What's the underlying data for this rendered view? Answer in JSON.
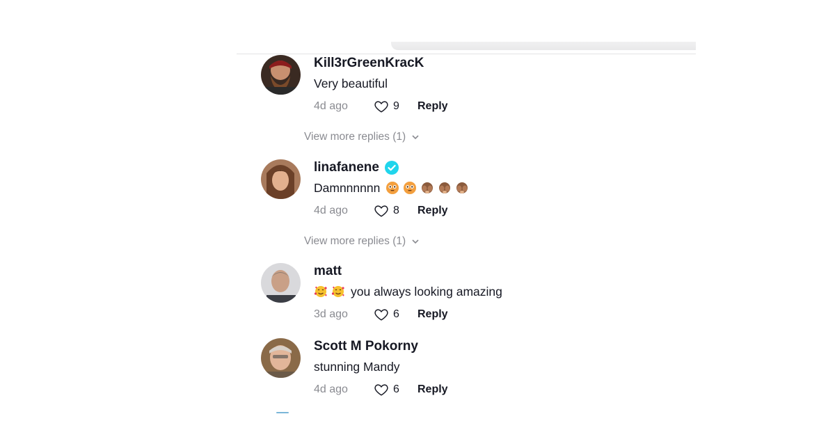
{
  "comments": [
    {
      "username": "Kill3rGreenKracK",
      "text": "Very beautiful",
      "time": "4d ago",
      "likes": "9",
      "reply": "Reply",
      "verified": false
    },
    {
      "username": "linafanene",
      "text": "Damnnnnnn",
      "time": "4d ago",
      "likes": "8",
      "reply": "Reply",
      "verified": true
    },
    {
      "username": "matt",
      "text": "you always looking amazing",
      "time": "3d ago",
      "likes": "6",
      "reply": "Reply",
      "verified": false
    },
    {
      "username": "Scott M Pokorny",
      "text": "stunning Mandy",
      "time": "4d ago",
      "likes": "6",
      "reply": "Reply",
      "verified": false
    }
  ],
  "view_more": [
    "View more replies (1)",
    "View more replies (1)"
  ],
  "icons": {
    "like": "heart-outline-icon",
    "verified": "verified-check-icon",
    "expand": "chevron-down-icon",
    "emoji_flushed": "flushed-face-emoji",
    "emoji_see_no_evil": "see-no-evil-emoji",
    "emoji_hugging": "smiling-face-with-hearts-emoji"
  },
  "colors": {
    "verified": "#20d5ec",
    "muted": "#8a8b91",
    "text": "#161823"
  }
}
